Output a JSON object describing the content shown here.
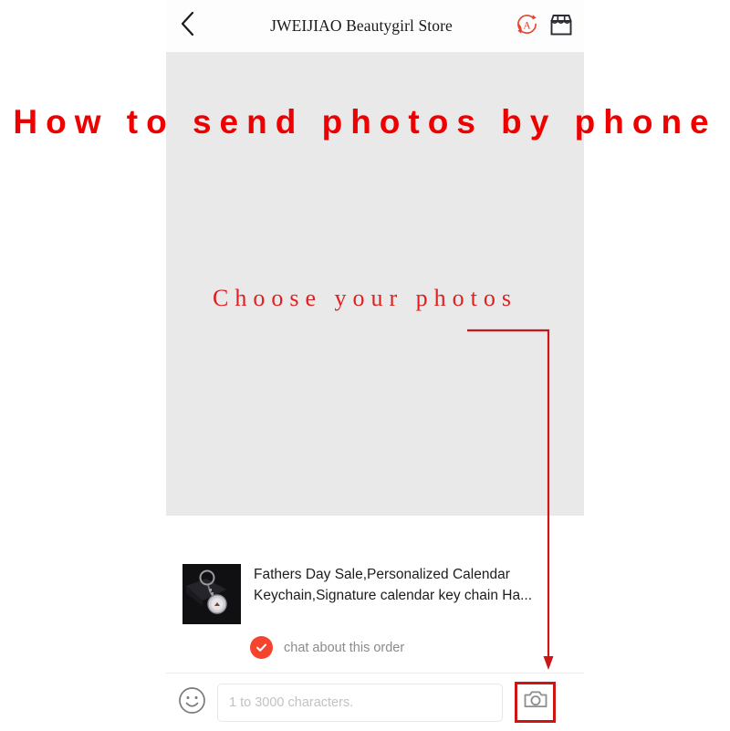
{
  "colors": {
    "annotation_red": "#EE0000",
    "annotation_red_dark": "#CC1515",
    "accent_red": "#F4442E",
    "panel_gray": "#E9E9EA",
    "placeholder_gray": "#C2C2C2"
  },
  "header": {
    "back_icon": "chevron-left-icon",
    "title": "JWEIJIAO Beautygirl Store",
    "translate_icon": "translate-a-icon",
    "store_icon": "store-front-icon"
  },
  "annotations": {
    "title": "How to send photos by phone",
    "choose": "Choose your photos",
    "arrow_icon": "elbow-arrow-down-icon",
    "highlight_target": "camera-button"
  },
  "product": {
    "thumbnail_alt": "keychain-product-photo",
    "title": "Fathers Day Sale,Personalized Calendar Keychain,Signature calendar key chain Ha...",
    "chat_check_icon": "check-circle-icon",
    "chat_label": "chat about this order"
  },
  "input_bar": {
    "emoji_icon": "smiley-face-icon",
    "message_value": "",
    "message_placeholder": "1 to 3000 characters.",
    "camera_icon": "camera-icon"
  }
}
